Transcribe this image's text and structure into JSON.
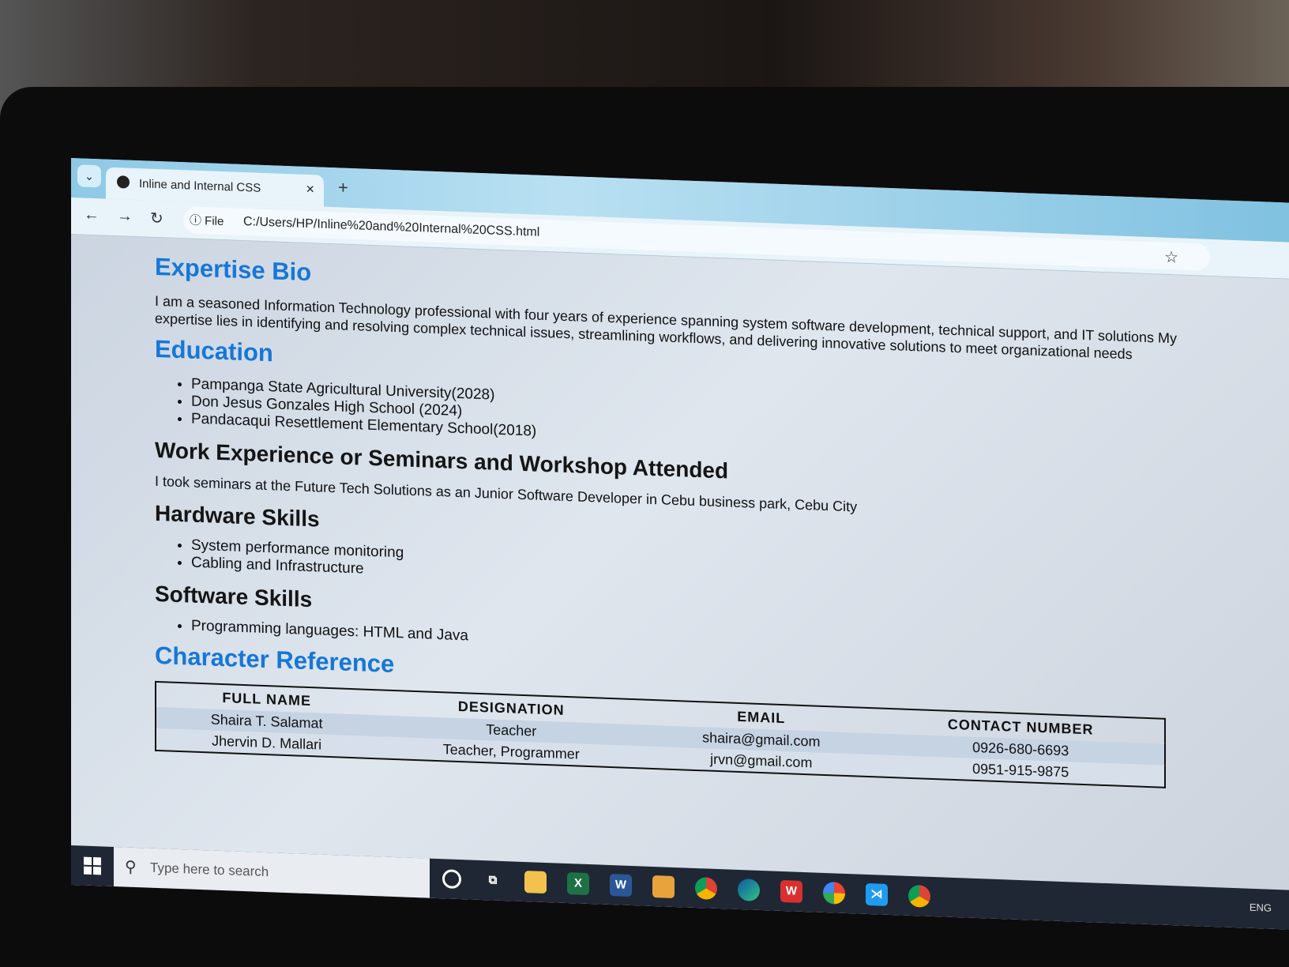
{
  "browser": {
    "tab_title": "Inline and Internal CSS",
    "tab_close": "×",
    "new_tab": "+",
    "file_label": "File",
    "url": "C:/Users/HP/Inline%20and%20Internal%20CSS.html"
  },
  "page": {
    "expertise": {
      "heading": "Expertise Bio",
      "text": "I am a seasoned Information Technology professional with four years of experience spanning system software development, technical support, and IT solutions My expertise lies in identifying and resolving complex technical issues, streamlining workflows, and delivering innovative solutions to meet organizational needs"
    },
    "education": {
      "heading": "Education",
      "items": [
        "Pampanga State Agricultural University(2028)",
        "Don Jesus Gonzales High School (2024)",
        "Pandacaqui Resettlement Elementary School(2018)"
      ]
    },
    "work": {
      "heading": "Work Experience or Seminars and Workshop Attended",
      "text": "I took seminars at the Future Tech Solutions as an Junior Software Developer in Cebu business park, Cebu City"
    },
    "hardware": {
      "heading": "Hardware Skills",
      "items": [
        "System performance monitoring",
        "Cabling and Infrastructure"
      ]
    },
    "software": {
      "heading": "Software Skills",
      "items": [
        "Programming languages: HTML and Java"
      ]
    },
    "reference": {
      "heading": "Character Reference",
      "columns": [
        "FULL NAME",
        "DESIGNATION",
        "EMAIL",
        "CONTACT NUMBER"
      ],
      "rows": [
        [
          "Shaira T. Salamat",
          "Teacher",
          "shaira@gmail.com",
          "0926-680-6693"
        ],
        [
          "Jhervin D. Mallari",
          "Teacher, Programmer",
          "jrvn@gmail.com",
          "0951-915-9875"
        ]
      ]
    }
  },
  "taskbar": {
    "search_placeholder": "Type here to search",
    "tray_lang": "ENG"
  }
}
